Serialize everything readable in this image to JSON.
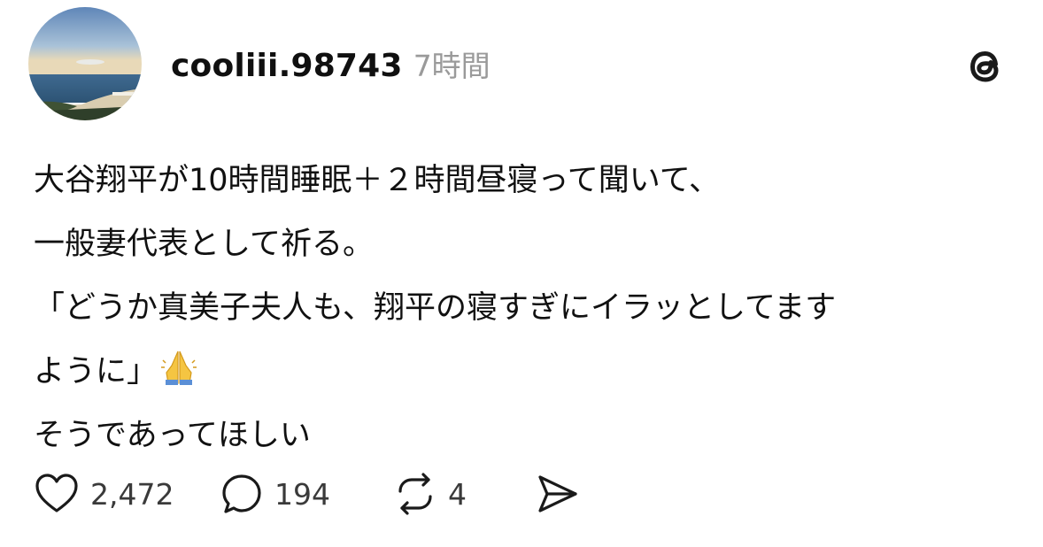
{
  "post": {
    "author": {
      "username": "cooliii.98743",
      "avatar_icon": "beach-landscape-avatar"
    },
    "timestamp": "7時間",
    "app_icon": "threads-logo-icon",
    "lines": [
      "大谷翔平が10時間睡眠＋２時間昼寝って聞いて、",
      "一般妻代表として祈る。",
      "「どうか真美子夫人も、翔平の寝すぎにイラッとしてます",
      "ように」",
      "そうであってほしい"
    ],
    "inline_emoji": "folded-hands-emoji",
    "actions": {
      "like_count": "2,472",
      "reply_count": "194",
      "repost_count": "4"
    }
  },
  "colors": {
    "text": "#111111",
    "muted": "#9a9a9a",
    "count": "#3a3a3a",
    "icon": "#1a1a1a"
  }
}
